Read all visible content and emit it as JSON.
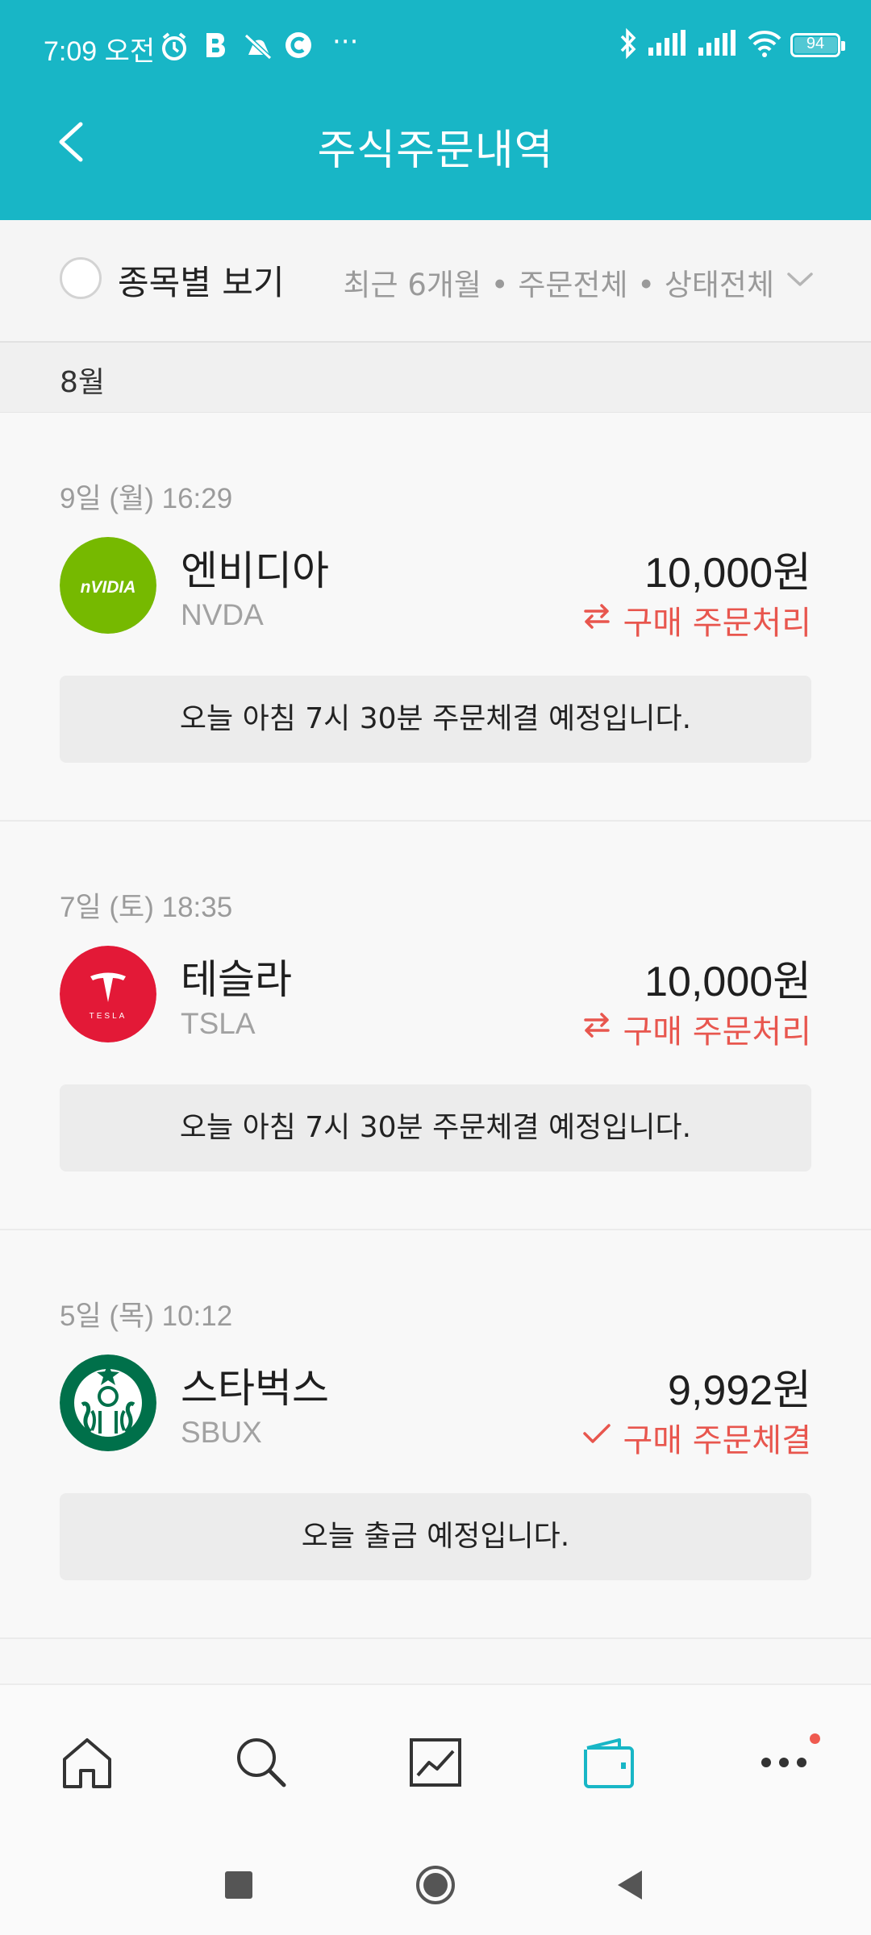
{
  "status_bar": {
    "time": "7:09 오전",
    "battery": "94",
    "more": "···",
    "icons": [
      "alarm-icon",
      "b-app-icon",
      "mute-icon",
      "c-app-icon",
      "bluetooth-icon",
      "signal-icon",
      "signal-icon",
      "wifi-icon",
      "battery-icon"
    ]
  },
  "header": {
    "title": "주식주문내역",
    "back_icon": "chevron-left-icon"
  },
  "filter": {
    "view_by_stock_label": "종목별 보기",
    "summary": "최근 6개월 • 주문전체 • 상태전체",
    "dropdown_icon": "chevron-down-icon"
  },
  "month_label": "8월",
  "orders": [
    {
      "datetime": "9일 (월) 16:29",
      "name": "엔비디아",
      "ticker": "NVDA",
      "amount": "10,000원",
      "status": "구매 주문처리",
      "status_icon": "exchange-icon",
      "note": "오늘 아침 7시 30분 주문체결 예정입니다.",
      "logo_text": "nVIDIA",
      "logo_color": "#76b900"
    },
    {
      "datetime": "7일 (토) 18:35",
      "name": "테슬라",
      "ticker": "TSLA",
      "amount": "10,000원",
      "status": "구매 주문처리",
      "status_icon": "exchange-icon",
      "note": "오늘 아침 7시 30분 주문체결 예정입니다.",
      "logo_text": "TESLA",
      "logo_color": "#e31937"
    },
    {
      "datetime": "5일 (목) 10:12",
      "name": "스타벅스",
      "ticker": "SBUX",
      "amount": "9,992원",
      "status": "구매 주문체결",
      "status_icon": "check-icon",
      "note": "오늘 출금 예정입니다.",
      "logo_text": "",
      "logo_color": "#00704a"
    }
  ],
  "bottom_nav": [
    {
      "name": "home",
      "icon": "home-icon",
      "active": false
    },
    {
      "name": "search",
      "icon": "search-icon",
      "active": false
    },
    {
      "name": "chart",
      "icon": "chart-icon",
      "active": false
    },
    {
      "name": "wallet",
      "icon": "wallet-icon",
      "active": true
    },
    {
      "name": "more",
      "icon": "more-icon",
      "active": false,
      "badge": true
    }
  ],
  "colors": {
    "header_teal": "#18b6c6",
    "accent_red": "#e8564e",
    "active_tab": "#18b6c6"
  }
}
